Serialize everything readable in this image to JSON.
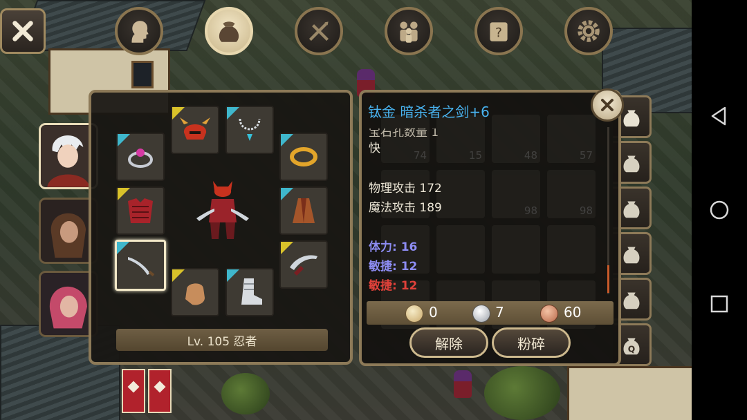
{
  "top_menu": {
    "items": [
      {
        "name": "character",
        "icon": "head-silhouette-icon",
        "active": false
      },
      {
        "name": "inventory",
        "icon": "bag-icon",
        "active": true
      },
      {
        "name": "skills",
        "icon": "crossed-swords-icon",
        "active": false
      },
      {
        "name": "party",
        "icon": "people-icon",
        "active": false
      },
      {
        "name": "quest",
        "icon": "scroll-question-icon",
        "active": false
      },
      {
        "name": "settings",
        "icon": "gear-icon",
        "active": false
      }
    ]
  },
  "equipment": {
    "level_label": "Lv. 105 忍者",
    "party_portraits": [
      "white-haired-hero",
      "brown-haired-rogue",
      "pink-haired-mage"
    ],
    "slots": [
      {
        "name": "helmet",
        "icon": "demon-helmet-icon",
        "rarity": "gold"
      },
      {
        "name": "necklace",
        "icon": "necklace-icon",
        "rarity": "blue"
      },
      {
        "name": "ring-left",
        "icon": "gem-ring-icon",
        "rarity": "blue"
      },
      {
        "name": "ring-right",
        "icon": "gold-ring-icon",
        "rarity": "blue"
      },
      {
        "name": "armor",
        "icon": "red-armor-icon",
        "rarity": "gold"
      },
      {
        "name": "cloak",
        "icon": "cloak-icon",
        "rarity": "blue"
      },
      {
        "name": "weapon-main",
        "icon": "curved-sword-icon",
        "rarity": "blue",
        "selected": true
      },
      {
        "name": "weapon-off",
        "icon": "dual-blade-icon",
        "rarity": "gold"
      },
      {
        "name": "gloves",
        "icon": "glove-icon",
        "rarity": "gold"
      },
      {
        "name": "boots",
        "icon": "armored-boot-icon",
        "rarity": "blue"
      }
    ]
  },
  "item_detail": {
    "title": "钛金 暗杀者之剑+6",
    "cut_line": "宝石孔数量 1",
    "speed": "快",
    "physical_attack": "物理攻击 172",
    "magic_attack": "魔法攻击 189",
    "stamina": "体力: 16",
    "agility_1": "敏捷: 12",
    "agility_2": "敏捷: 12",
    "stamina_color": "#8d8cf2",
    "agility_color": "#8d8cf2",
    "agility_red_color": "#e0413a",
    "title_color": "#49b3f0"
  },
  "currency": {
    "gold": "0",
    "silver": "7",
    "copper": "60"
  },
  "actions": {
    "unequip": "解除",
    "smash": "粉碎"
  },
  "background_grid_counts": [
    "74",
    "15",
    "48",
    "57",
    "98",
    "98"
  ]
}
